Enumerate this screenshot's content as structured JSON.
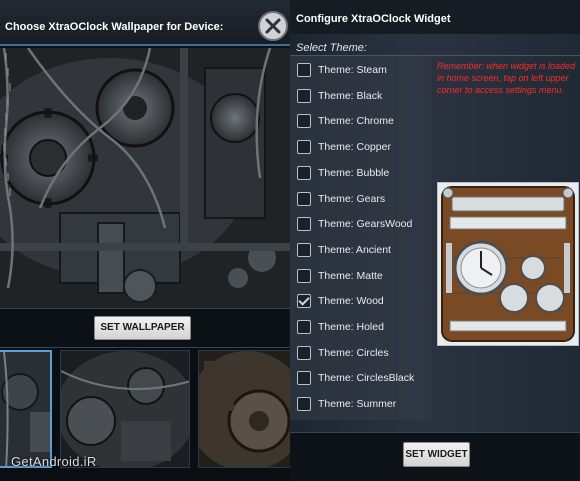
{
  "left_dialog": {
    "title": "Choose XtraOClock Wallpaper for Device:",
    "set_wallpaper_label": "SET WALLPAPER",
    "watermark": "GetAndroid.iR"
  },
  "right_dialog": {
    "title": "Configure XtraOClock Widget",
    "select_theme_caption": "Select Theme:",
    "themes": [
      {
        "label": "Theme: Steam",
        "checked": false
      },
      {
        "label": "Theme: Black",
        "checked": false
      },
      {
        "label": "Theme: Chrome",
        "checked": false
      },
      {
        "label": "Theme: Copper",
        "checked": false
      },
      {
        "label": "Theme: Bubble",
        "checked": false
      },
      {
        "label": "Theme: Gears",
        "checked": false
      },
      {
        "label": "Theme: GearsWood",
        "checked": false
      },
      {
        "label": "Theme: Ancient",
        "checked": false
      },
      {
        "label": "Theme: Matte",
        "checked": false
      },
      {
        "label": "Theme: Wood",
        "checked": true
      },
      {
        "label": "Theme: Holed",
        "checked": false
      },
      {
        "label": "Theme: Circles",
        "checked": false
      },
      {
        "label": "Theme: CirclesBlack",
        "checked": false
      },
      {
        "label": "Theme: Summer",
        "checked": false
      }
    ],
    "reminder": "Remember: when widget is loaded in home screen, tap on left upper corner to access settings menu.",
    "set_widget_label": "SET WIDGET"
  },
  "colors": {
    "reminder_text": "#ff2a2a",
    "accent_border": "#3c6f9a",
    "button_face": "#e3e3e3"
  },
  "icons": {
    "close": "close-icon",
    "checkbox_checked": "checkmark-icon"
  }
}
